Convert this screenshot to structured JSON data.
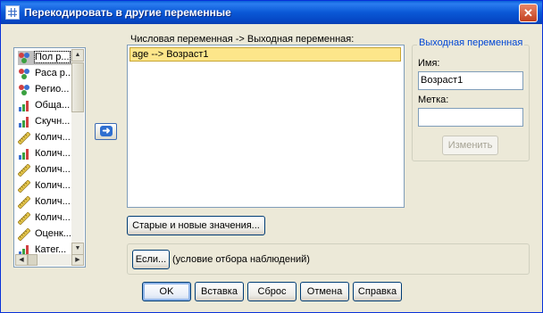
{
  "window": {
    "title": "Перекодировать в другие переменные",
    "close_symbol": "✕"
  },
  "variables": [
    {
      "label": "Пол р...",
      "icon": "nominal-variable-icon",
      "selected": true
    },
    {
      "label": "Раса р...",
      "icon": "nominal-variable-icon"
    },
    {
      "label": "Регио...",
      "icon": "nominal-variable-icon"
    },
    {
      "label": "Обща...",
      "icon": "ordinal-variable-icon"
    },
    {
      "label": "Скучн...",
      "icon": "ordinal-variable-icon"
    },
    {
      "label": "Колич...",
      "icon": "scale-variable-icon"
    },
    {
      "label": "Колич...",
      "icon": "ordinal-variable-icon"
    },
    {
      "label": "Колич...",
      "icon": "scale-variable-icon"
    },
    {
      "label": "Колич...",
      "icon": "scale-variable-icon"
    },
    {
      "label": "Колич...",
      "icon": "scale-variable-icon"
    },
    {
      "label": "Колич...",
      "icon": "scale-variable-icon"
    },
    {
      "label": "Оценк...",
      "icon": "scale-variable-icon"
    },
    {
      "label": "Катег...",
      "icon": "ordinal-variable-icon"
    }
  ],
  "mapping": {
    "header": "Числовая переменная -> Выходная переменная:",
    "rows": [
      "age --> Возраст1"
    ]
  },
  "output_variable": {
    "legend": "Выходная переменная",
    "name_label": "Имя:",
    "name_value": "Возраст1",
    "label_label": "Метка:",
    "label_value": "",
    "change_button": "Изменить"
  },
  "old_new_button": "Старые и новые значения...",
  "if_section": {
    "button": "Если...",
    "caption": "(условие отбора наблюдений)"
  },
  "buttons": {
    "ok": "OK",
    "paste": "Вставка",
    "reset": "Сброс",
    "cancel": "Отмена",
    "help": "Справка"
  },
  "colors": {
    "titlebar": "#0a58d6",
    "selection_highlight": "#fde68a",
    "group_legend": "#0046d5"
  }
}
